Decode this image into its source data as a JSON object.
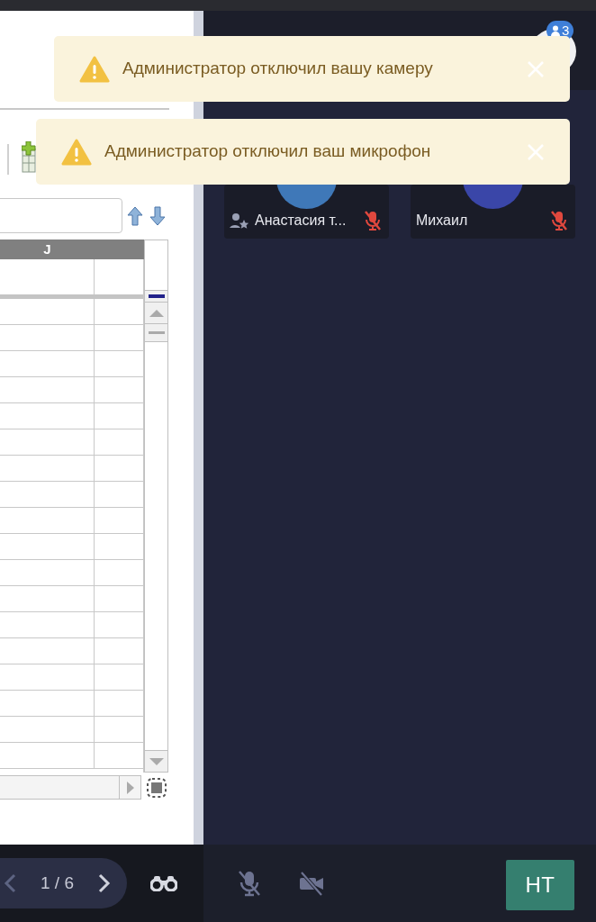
{
  "document": {
    "column_header": "J"
  },
  "participants_badge": "3",
  "notifications": [
    {
      "text": "Администратор отключил вашу камеру"
    },
    {
      "text": "Администратор отключил ваш микрофон"
    }
  ],
  "tiles": [
    {
      "name": "Анастасия т...",
      "moderator": true,
      "muted": true
    },
    {
      "name": "Михаил",
      "moderator": false,
      "muted": true
    }
  ],
  "pager": {
    "label": "1 / 6"
  },
  "controls": {
    "mic_on": false,
    "camera_on": false
  },
  "user_button": "НТ"
}
